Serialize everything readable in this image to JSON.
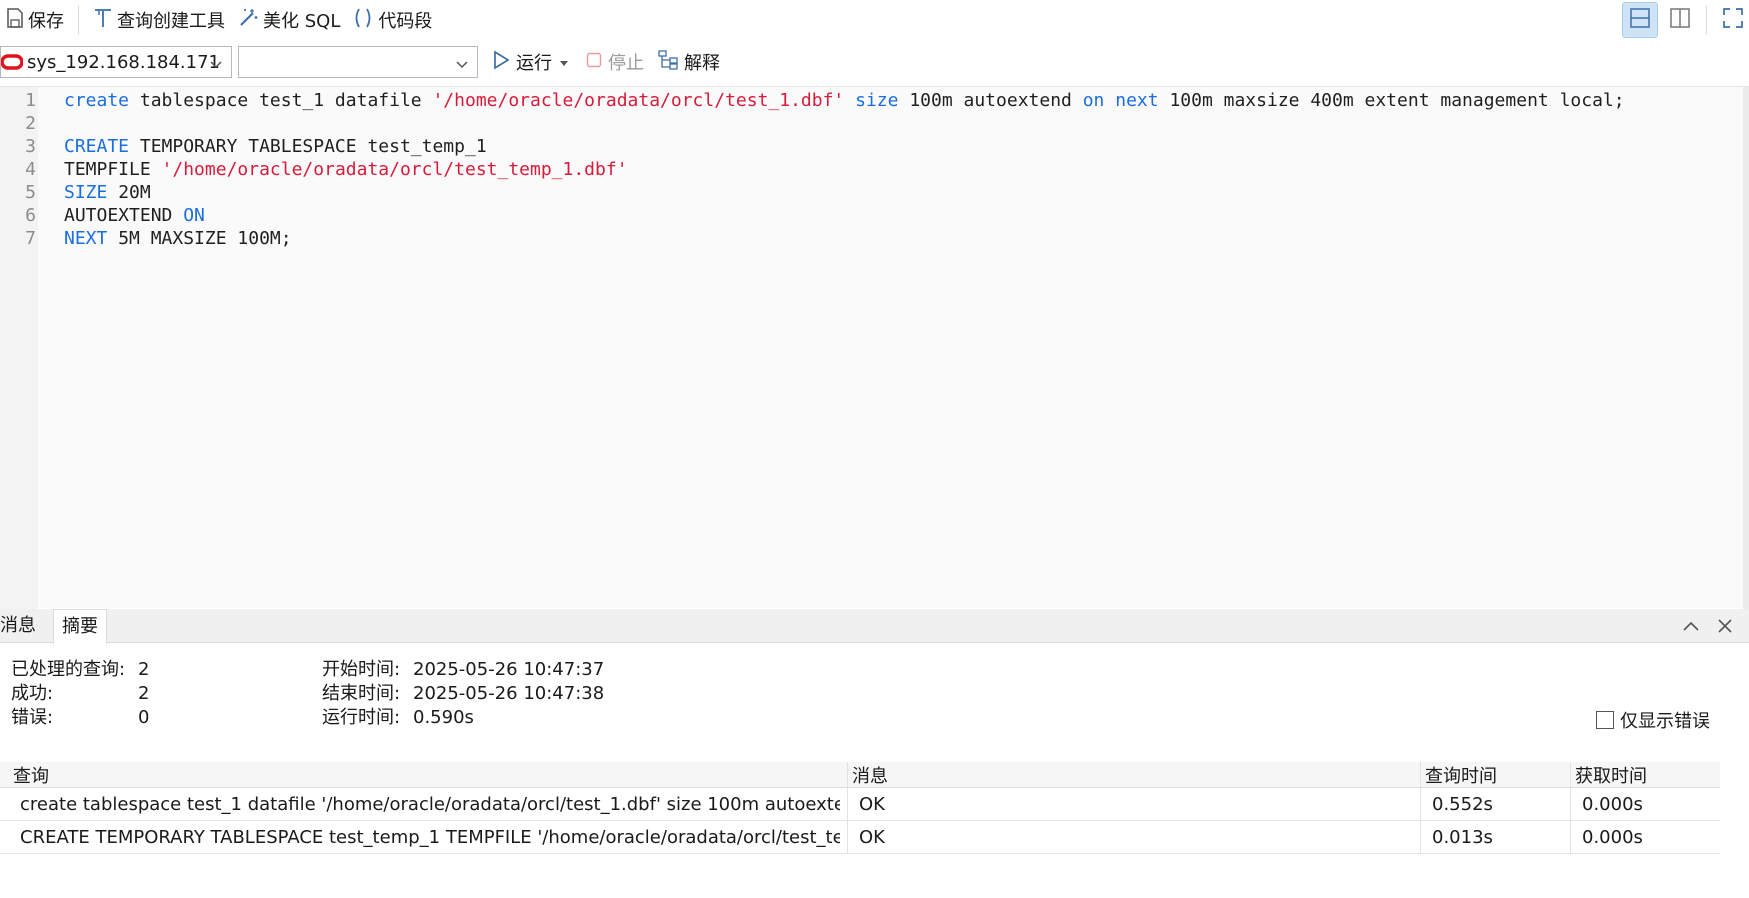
{
  "toolbar": {
    "save_label": "保存",
    "query_builder_label": "查询创建工具",
    "beautify_label": "美化 SQL",
    "snippet_label": "代码段"
  },
  "connection": {
    "selected": "sys_192.168.184.171",
    "schema_selected": ""
  },
  "actions": {
    "run_label": "运行",
    "stop_label": "停止",
    "explain_label": "解释"
  },
  "editor": {
    "lines": [
      {
        "n": "1",
        "tokens": [
          {
            "t": "create",
            "c": "kw"
          },
          {
            "t": " tablespace test_1 datafile ",
            "c": ""
          },
          {
            "t": "'/home/oracle/oradata/orcl/test_1.dbf'",
            "c": "str"
          },
          {
            "t": " ",
            "c": ""
          },
          {
            "t": "size",
            "c": "kw"
          },
          {
            "t": " 100m autoextend ",
            "c": ""
          },
          {
            "t": "on",
            "c": "kw"
          },
          {
            "t": " ",
            "c": ""
          },
          {
            "t": "next",
            "c": "kw"
          },
          {
            "t": " 100m maxsize 400m extent management local;",
            "c": ""
          }
        ]
      },
      {
        "n": "2",
        "tokens": []
      },
      {
        "n": "3",
        "tokens": [
          {
            "t": "CREATE",
            "c": "kw"
          },
          {
            "t": " TEMPORARY TABLESPACE test_temp_1",
            "c": ""
          }
        ]
      },
      {
        "n": "4",
        "tokens": [
          {
            "t": "TEMPFILE ",
            "c": ""
          },
          {
            "t": "'/home/oracle/oradata/orcl/test_temp_1.dbf'",
            "c": "str"
          }
        ]
      },
      {
        "n": "5",
        "tokens": [
          {
            "t": "SIZE",
            "c": "kw"
          },
          {
            "t": " 20M",
            "c": ""
          }
        ]
      },
      {
        "n": "6",
        "tokens": [
          {
            "t": "AUTOEXTEND ",
            "c": ""
          },
          {
            "t": "ON",
            "c": "kw"
          }
        ]
      },
      {
        "n": "7",
        "tokens": [
          {
            "t": "NEXT",
            "c": "kw"
          },
          {
            "t": " 5M MAXSIZE 100M;",
            "c": ""
          }
        ]
      }
    ]
  },
  "tabs": {
    "messages": "消息",
    "summary": "摘要"
  },
  "summary": {
    "processed_label": "已处理的查询:",
    "processed_value": "2",
    "success_label": "成功:",
    "success_value": "2",
    "error_label": "错误:",
    "error_value": "0",
    "start_label": "开始时间:",
    "start_value": "2025-05-26 10:47:37",
    "end_label": "结束时间:",
    "end_value": "2025-05-26 10:47:38",
    "elapsed_label": "运行时间:",
    "elapsed_value": "0.590s",
    "only_errors_label": "仅显示错误"
  },
  "results": {
    "columns": [
      "查询",
      "消息",
      "查询时间",
      "获取时间"
    ],
    "rows": [
      [
        "create tablespace test_1 datafile '/home/oracle/oradata/orcl/test_1.dbf' size 100m autoexten...",
        "OK",
        "0.552s",
        "0.000s"
      ],
      [
        "CREATE TEMPORARY TABLESPACE test_temp_1 TEMPFILE '/home/oracle/oradata/orcl/test_te...",
        "OK",
        "0.013s",
        "0.000s"
      ]
    ]
  },
  "colors": {
    "keyword": "#1a6ee0",
    "string": "#d81b3a",
    "oracle_red": "#e0141e",
    "accent": "#1a73c9"
  }
}
